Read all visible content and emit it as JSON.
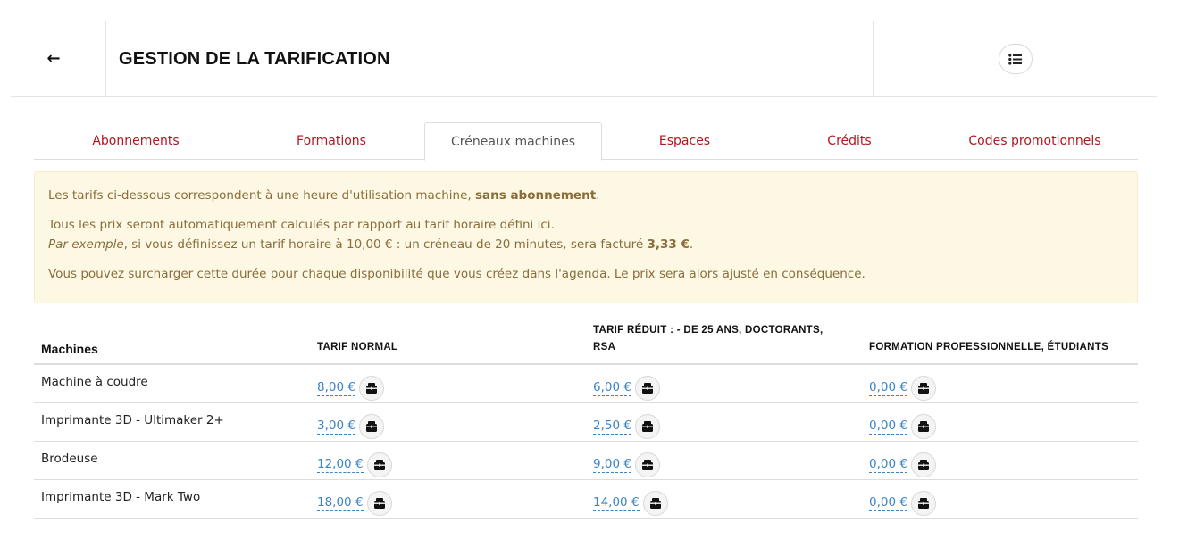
{
  "header": {
    "back_icon": "arrow-left-icon",
    "title": "GESTION DE LA TARIFICATION",
    "menu_icon": "list-icon"
  },
  "tabs": [
    {
      "label": "Abonnements",
      "active": false
    },
    {
      "label": "Formations",
      "active": false
    },
    {
      "label": "Créneaux machines",
      "active": true
    },
    {
      "label": "Espaces",
      "active": false
    },
    {
      "label": "Crédits",
      "active": false
    },
    {
      "label": "Codes promotionnels",
      "active": false
    }
  ],
  "alert": {
    "line1_pre": "Les tarifs ci-dessous correspondent à une heure d'utilisation machine, ",
    "line1_bold": "sans abonnement",
    "line1_post": ".",
    "line2": "Tous les prix seront automatiquement calculés par rapport au tarif horaire défini ici.",
    "line3_italic": "Par exemple",
    "line3_mid": ", si vous définissez un tarif horaire à 10,00 € : un créneau de 20 minutes, sera facturé ",
    "line3_bold": "3,33 €",
    "line3_post": ".",
    "line4": "Vous pouvez surcharger cette durée pour chaque disponibilité que vous créez dans l'agenda. Le prix sera alors ajusté en conséquence."
  },
  "table": {
    "headers": {
      "machines": "Machines",
      "normal": "TARIF NORMAL",
      "reduced_l1": "TARIF RÉDUIT : - DE 25 ANS, DOCTORANTS,",
      "reduced_l2": "RSA",
      "professional": "FORMATION PROFESSIONNELLE, ÉTUDIANTS"
    },
    "price_icon": "wallet-icon",
    "rows": [
      {
        "machine": "Machine à coudre",
        "normal": "8,00 €",
        "reduced": "6,00 €",
        "professional": "0,00 €"
      },
      {
        "machine": "Imprimante 3D - Ultimaker 2+",
        "normal": "3,00 €",
        "reduced": "2,50 €",
        "professional": "0,00 €"
      },
      {
        "machine": "Brodeuse",
        "normal": "12,00 €",
        "reduced": "9,00 €",
        "professional": "0,00 €"
      },
      {
        "machine": "Imprimante 3D - Mark Two",
        "normal": "18,00 €",
        "reduced": "14,00 €",
        "professional": "0,00 €"
      }
    ]
  },
  "colors": {
    "tab_link": "#b0171f",
    "price_link": "#3a84c4",
    "alert_bg": "#fcf8e3",
    "alert_text": "#8a6d3b"
  }
}
